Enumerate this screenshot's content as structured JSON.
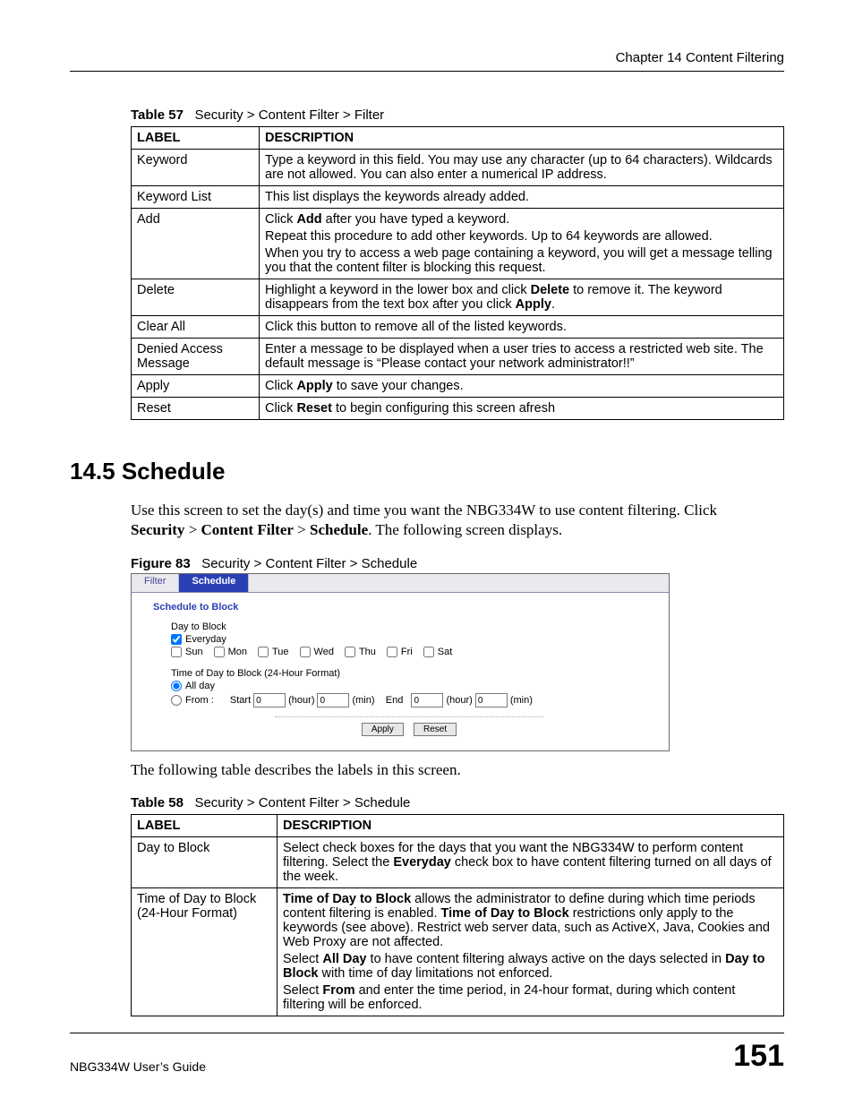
{
  "header": {
    "chapter_line": "Chapter 14 Content Filtering"
  },
  "table57": {
    "caption_num": "Table 57",
    "caption_text": "Security > Content Filter > Filter",
    "head_label": "LABEL",
    "head_desc": "DESCRIPTION",
    "rows": [
      {
        "label": "Keyword",
        "desc": [
          "Type a keyword in this field. You may use any character (up to 64 characters). Wildcards are not allowed. You can also enter a numerical IP address."
        ]
      },
      {
        "label": "Keyword List",
        "desc": [
          "This list displays the keywords already added."
        ]
      },
      {
        "label": "Add",
        "desc": [
          "Click <b>Add</b> after you have typed a keyword.",
          "Repeat this procedure to add other keywords. Up to 64 keywords are allowed.",
          "When you try to access a web page containing a keyword, you will get a message telling you that the content filter is blocking this request."
        ]
      },
      {
        "label": "Delete",
        "desc": [
          "Highlight a keyword in the lower box and click <b>Delete</b> to remove it. The keyword disappears from the text box after you click <b>Apply</b>."
        ]
      },
      {
        "label": "Clear All",
        "desc": [
          "Click this button to remove all of the listed keywords."
        ]
      },
      {
        "label": "Denied Access Message",
        "desc": [
          "Enter a message to be displayed when a user tries to access a restricted web site. The default message is “Please contact your network administrator!!”"
        ]
      },
      {
        "label": "Apply",
        "desc": [
          "Click <b>Apply</b> to save your changes."
        ]
      },
      {
        "label": "Reset",
        "desc": [
          "Click <b>Reset</b> to begin configuring this screen afresh"
        ]
      }
    ]
  },
  "section": {
    "heading": "14.5  Schedule",
    "para1_pre": "Use this screen to set the day(s) and time you want the NBG334W to use content filtering. Click ",
    "bc1": "Security",
    "bc2": "Content Filter",
    "bc3": "Schedule",
    "para1_post": ". The following screen displays."
  },
  "figure83": {
    "caption_num": "Figure 83",
    "caption_text": "Security > Content Filter > Schedule",
    "tab_filter": "Filter",
    "tab_schedule": "Schedule",
    "panel_title": "Schedule to Block",
    "day_label": "Day to Block",
    "everyday": "Everyday",
    "days": [
      "Sun",
      "Mon",
      "Tue",
      "Wed",
      "Thu",
      "Fri",
      "Sat"
    ],
    "time_label": "Time of Day to Block (24-Hour Format)",
    "all_day": "All day",
    "from_label": "From :",
    "start_label": "Start",
    "end_label": "End",
    "hour_label": "(hour)",
    "min_label": "(min)",
    "val_zero": "0",
    "btn_apply": "Apply",
    "btn_reset": "Reset"
  },
  "after_fig": "The following table describes the labels in this screen.",
  "table58": {
    "caption_num": "Table 58",
    "caption_text": "Security > Content Filter > Schedule",
    "head_label": "LABEL",
    "head_desc": "DESCRIPTION",
    "rows": [
      {
        "label": "Day to Block",
        "desc": [
          "Select check boxes for the days that you want the NBG334W to perform content filtering. Select the <b>Everyday</b> check box to have content filtering turned on all days of the week."
        ]
      },
      {
        "label": "Time of Day to Block (24-Hour Format)",
        "desc": [
          "<b>Time of Day to Block</b> allows the administrator to define during which time periods content filtering is enabled. <b>Time of Day to Block</b> restrictions only apply to the keywords (see above). Restrict web server data, such as ActiveX, Java, Cookies and Web Proxy are not affected.",
          "Select  <b>All Day</b> to have content filtering always active on the days selected in <b>Day to Block</b> with time of day limitations not enforced.",
          "Select <b>From</b> and enter the time period, in 24-hour format, during which content filtering will be enforced."
        ]
      }
    ]
  },
  "footer": {
    "guide": "NBG334W User’s Guide",
    "page": "151"
  }
}
